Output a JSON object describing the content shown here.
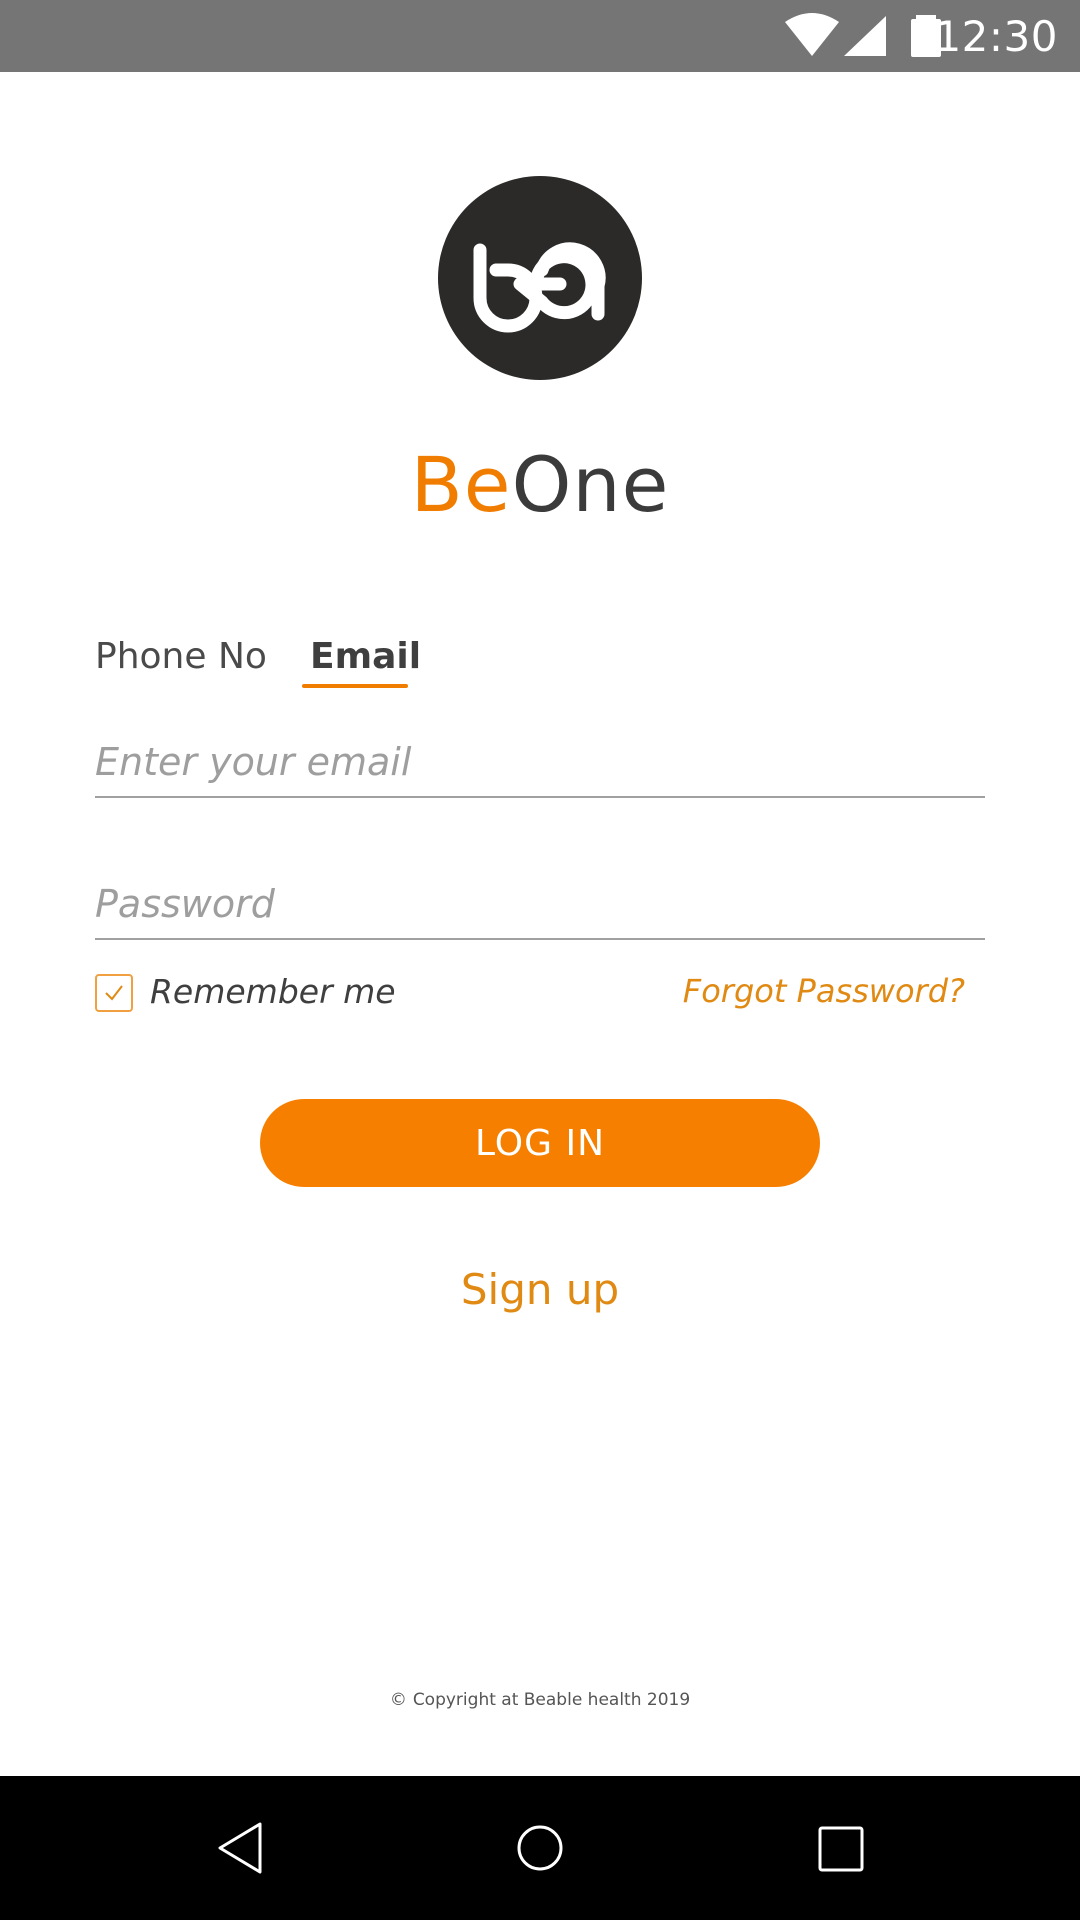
{
  "status_bar": {
    "time": "12:30",
    "icons": [
      "wifi-icon",
      "signal-icon",
      "battery-icon"
    ],
    "background": "#757575"
  },
  "logo": {
    "icon": "beone-logo-icon",
    "background": "#2b2a29"
  },
  "brand": {
    "part1": "Be",
    "part2": "One",
    "accent": "#f07d00"
  },
  "tabs": [
    {
      "label": "Phone No",
      "selected": false
    },
    {
      "label": "Email",
      "selected": true
    }
  ],
  "form": {
    "email_placeholder": "Enter your email",
    "email_value": "",
    "password_placeholder": "Password",
    "password_value": "",
    "remember_label": "Remember me",
    "remember_checked": true,
    "forgot_label": "Forgot Password?"
  },
  "actions": {
    "login_label": "LOG IN",
    "signup_label": "Sign up",
    "button_color": "#f77f00"
  },
  "footer": {
    "copyright_symbol": "©",
    "copyright_text": "Copyright at Beable health 2019"
  },
  "nav_bar": {
    "buttons": [
      "back-icon",
      "home-icon",
      "recents-icon"
    ]
  }
}
